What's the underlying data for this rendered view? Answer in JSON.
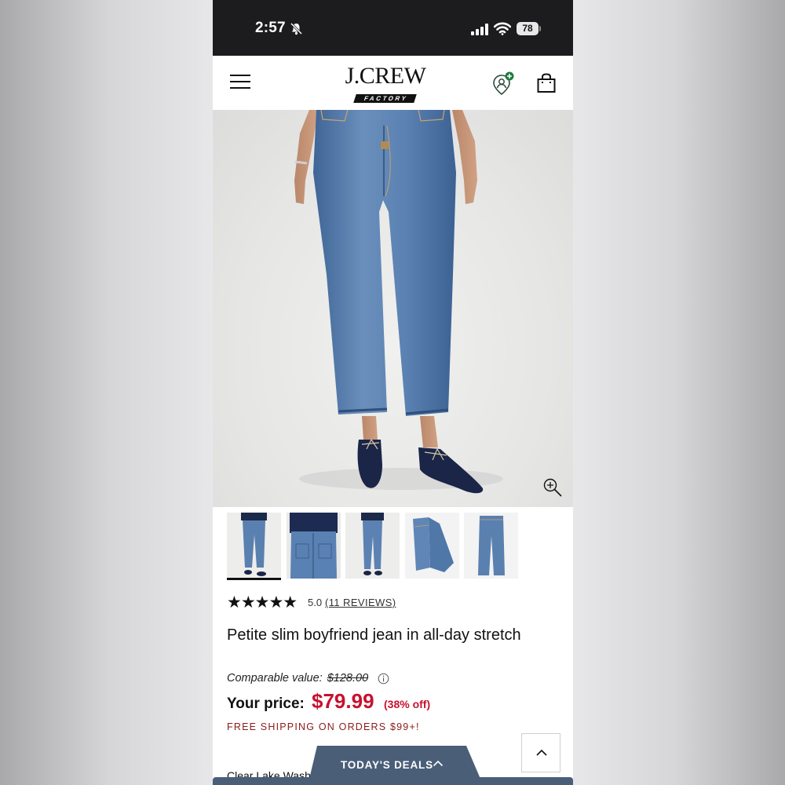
{
  "status_bar": {
    "time": "2:57",
    "battery": "78"
  },
  "header": {
    "logo_main": "J.CREW",
    "logo_sub": "FACTORY"
  },
  "product": {
    "rating_stars": "★★★★★",
    "rating_value": "5.0",
    "reviews": "(11 REVIEWS)",
    "title": "Petite slim boyfriend jean in all-day stretch",
    "comparable_label": "Comparable value:",
    "comparable_price": "$128.00",
    "price_label": "Your price:",
    "price": "$79.99",
    "discount": "(38% off)",
    "shipping": "FREE SHIPPING ON ORDERS $99+!",
    "color": "Clear Lake Wash"
  },
  "thumbnails": [
    "front-view",
    "back-view",
    "side-view",
    "folded-jeans",
    "flat-jeans"
  ],
  "deals": {
    "label": "TODAY'S DEALS"
  },
  "colors": {
    "price_red": "#c8102e",
    "shipping_red": "#8b1a1a",
    "deals_bg": "#4a5e78",
    "denim": "#4f77a8"
  }
}
